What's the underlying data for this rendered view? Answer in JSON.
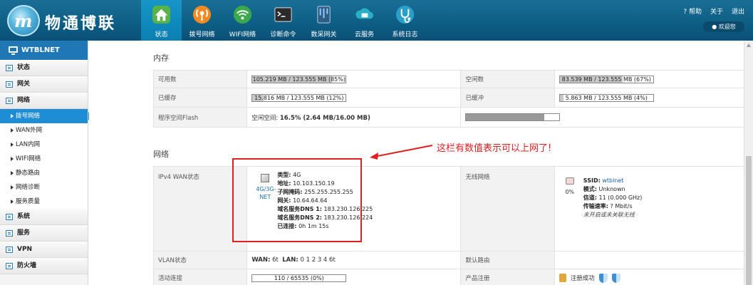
{
  "header": {
    "logo_letter": "m",
    "brand": "物通博联",
    "nav": [
      {
        "label": "状态",
        "icon": "home-icon"
      },
      {
        "label": "拨号网络",
        "icon": "dialup-icon"
      },
      {
        "label": "WIFI网络",
        "icon": "wifi-icon"
      },
      {
        "label": "诊断命令",
        "icon": "terminal-icon"
      },
      {
        "label": "数采网关",
        "icon": "gateway-icon"
      },
      {
        "label": "云服务",
        "icon": "cloud-icon"
      },
      {
        "label": "系统日志",
        "icon": "stethoscope-icon"
      }
    ],
    "help": "? 帮助",
    "about": "关于",
    "logout": "退出",
    "welcome": "欢迎您"
  },
  "sidebar": {
    "device_name": "WTBLNET",
    "items": [
      {
        "label": "状态",
        "type": "group"
      },
      {
        "label": "网关",
        "type": "group"
      },
      {
        "label": "网络",
        "type": "group"
      },
      {
        "label": "拨号网络",
        "type": "sub",
        "selected": true
      },
      {
        "label": "WAN外网",
        "type": "sub"
      },
      {
        "label": "LAN内网",
        "type": "sub"
      },
      {
        "label": "WIFI网络",
        "type": "sub"
      },
      {
        "label": "静态路由",
        "type": "sub"
      },
      {
        "label": "网络诊断",
        "type": "sub"
      },
      {
        "label": "服务质量",
        "type": "sub"
      },
      {
        "label": "系统",
        "type": "group"
      },
      {
        "label": "服务",
        "type": "group"
      },
      {
        "label": "VPN",
        "type": "group"
      },
      {
        "label": "防火墙",
        "type": "group"
      }
    ]
  },
  "memory": {
    "title": "内存",
    "available_label": "可用数",
    "available_text": "105.219 MB / 123.555 MB (85%)",
    "available_pct": 85,
    "free_label": "空闲数",
    "free_text": "83.539 MB / 123.555 MB (67%)",
    "free_pct": 67,
    "cached_label": "已缓存",
    "cached_text": "15.816 MB / 123.555 MB (12%)",
    "cached_pct": 12,
    "buffered_label": "已缓冲",
    "buffered_text": "5.863 MB / 123.555 MB (4%)",
    "buffered_pct": 4,
    "flash_label": "程序空间Flash",
    "flash_prefix": "空闲空间:",
    "flash_value": "16.5% (2.64 MB/16.00 MB)",
    "flash_pct": 83.5
  },
  "network": {
    "title": "网络",
    "wan_label": "IPv4 WAN状态",
    "wan_icon_label": "4G/3G-NET",
    "wan_type_k": "类型:",
    "wan_type_v": "4G",
    "wan_addr_k": "地址:",
    "wan_addr_v": "10.103.150.19",
    "wan_mask_k": "子网掩码:",
    "wan_mask_v": "255.255.255.255",
    "wan_gw_k": "网关:",
    "wan_gw_v": "10.64.64.64",
    "wan_dns1_k": "域名服务DNS 1:",
    "wan_dns1_v": "183.230.126.225",
    "wan_dns2_k": "域名服务DNS 2:",
    "wan_dns2_v": "183.230.126.224",
    "wan_conn_k": "已连接:",
    "wan_conn_v": "0h 1m 15s",
    "wireless_label": "无线网络",
    "wl_pct": "0%",
    "wl_ssid_k": "SSID:",
    "wl_ssid_v": "wtblnet",
    "wl_mode_k": "模式:",
    "wl_mode_v": "Unknown",
    "wl_chan_k": "信道:",
    "wl_chan_v": "11 (0.000 GHz)",
    "wl_rate_k": "传输速率:",
    "wl_rate_v": "? Mbit/s",
    "wl_note": "未开启或未关联无线",
    "vlan_label": "VLAN状态",
    "vlan_wan_k": "WAN:",
    "vlan_wan_v": "6t",
    "vlan_lan_k": "LAN:",
    "vlan_lan_v": "0 1 2 3 4 6t",
    "route_label": "默认路由",
    "conn_label": "活动连接",
    "conn_text": "110 / 65535 (0%)",
    "conn_pct": 0,
    "reg_label": "产品注册",
    "reg_text": "注册成功"
  },
  "annotation": "这栏有数值表示可以上网了!",
  "colors": {
    "header": "#0e5f86",
    "accent": "#1f8dd6",
    "annot": "#e02020"
  }
}
